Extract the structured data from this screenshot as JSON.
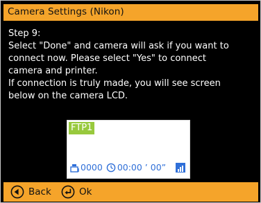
{
  "header": {
    "title": "Camera Settings (Nikon)"
  },
  "content": {
    "lines": [
      "Step 9:",
      "Select \"Done\" and camera will ask if you want to",
      "connect now.  Please select \"Yes\" to connect",
      "camera and printer.",
      "If connection is truly made, you will see screen",
      "below on the camera LCD."
    ]
  },
  "lcd": {
    "tag": "FTP1",
    "shot_count": "0000",
    "timer": "00:00 ’ 00”"
  },
  "footer": {
    "back_label": "Back",
    "ok_label": "Ok"
  },
  "colors": {
    "accent": "#f5a42a",
    "background": "#000000",
    "lcd_tag": "#98c93d",
    "lcd_text": "#2f6fd8"
  },
  "icons": [
    "left-arrow-circle-icon",
    "return-arrow-circle-icon",
    "clock-icon",
    "shot-counter-icon",
    "signal-bars-icon"
  ]
}
